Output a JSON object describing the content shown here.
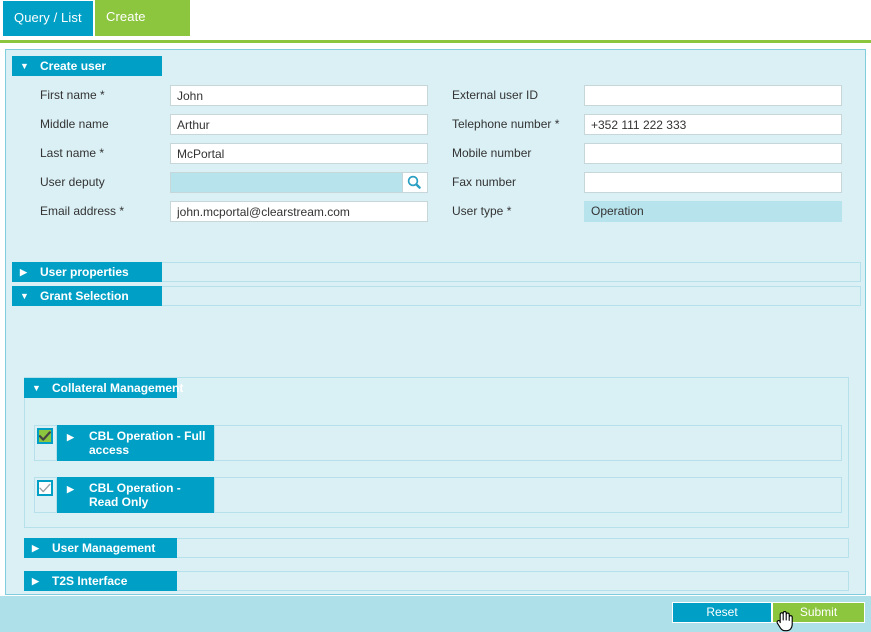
{
  "tabs": [
    {
      "label": "Query / List",
      "active": false
    },
    {
      "label": "Create",
      "active": true
    }
  ],
  "sections": {
    "create_user": {
      "label": "Create user",
      "expanded": true,
      "toggle_glyph": "▼"
    },
    "user_properties": {
      "label": "User properties",
      "expanded": false,
      "toggle_glyph": "▶"
    },
    "grant_selection": {
      "label": "Grant Selection",
      "expanded": true,
      "toggle_glyph": "▼"
    },
    "collateral_management": {
      "label": "Collateral Management",
      "expanded": true,
      "toggle_glyph": "▼"
    },
    "user_management": {
      "label": "User Management",
      "expanded": false,
      "toggle_glyph": "▶"
    },
    "t2s_interface": {
      "label": "T2S Interface",
      "expanded": false,
      "toggle_glyph": "▶"
    }
  },
  "form": {
    "left": [
      {
        "label": "First name",
        "required": true,
        "value": "John",
        "placeholder": ""
      },
      {
        "label": "Middle name",
        "required": false,
        "value": "Arthur",
        "placeholder": ""
      },
      {
        "label": "Last name",
        "required": true,
        "value": "McPortal",
        "placeholder": ""
      },
      {
        "label": "User deputy",
        "required": false,
        "value": "",
        "placeholder": "",
        "lookup": true,
        "lookup_icon": "search-icon"
      },
      {
        "label": "Email address",
        "required": true,
        "value": "john.mcportal@clearstream.com",
        "placeholder": ""
      }
    ],
    "right": [
      {
        "label": "External user ID",
        "required": false,
        "value": "",
        "placeholder": ""
      },
      {
        "label": "Telephone number",
        "required": true,
        "value": "+352 111 222 333",
        "placeholder": ""
      },
      {
        "label": "Mobile number",
        "required": false,
        "value": "",
        "placeholder": ""
      },
      {
        "label": "Fax number",
        "required": false,
        "value": "",
        "placeholder": ""
      },
      {
        "label": "User type",
        "required": true,
        "value": "Operation",
        "placeholder": "",
        "readonly": true
      }
    ],
    "required_marker": "*"
  },
  "grants": [
    {
      "label": "CBL Operation - Full access",
      "checked": true,
      "toggle_glyph": "▶"
    },
    {
      "label": "CBL Operation - Read Only",
      "checked": false,
      "toggle_glyph": "▶"
    }
  ],
  "footer": {
    "reset_label": "Reset",
    "submit_label": "Submit"
  },
  "colors": {
    "teal": "#00a0c6",
    "green": "#8cc63e",
    "panel_bg": "#daf0f5",
    "footer_bg": "#ade0e9",
    "border": "#b7e1ea"
  }
}
